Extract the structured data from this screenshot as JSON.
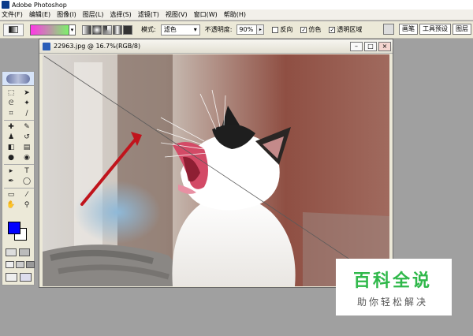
{
  "app": {
    "title": "Adobe Photoshop"
  },
  "menu": [
    "文件(F)",
    "编辑(E)",
    "图像(I)",
    "图层(L)",
    "选择(S)",
    "滤镜(T)",
    "视图(V)",
    "窗口(W)",
    "帮助(H)"
  ],
  "options": {
    "mode_label": "模式:",
    "mode_value": "滤色",
    "opacity_label": "不透明度:",
    "opacity_value": "90%",
    "reverse_label": "反向",
    "dither_label": "仿色",
    "transparency_label": "透明区域",
    "dither_checked": "✓",
    "transparency_checked": "✓"
  },
  "palette_well": {
    "tab1": "画笔",
    "tab2": "工具预设",
    "tab3": "图层"
  },
  "document": {
    "title": "22963.jpg @ 16.7%(RGB/8)"
  },
  "colors": {
    "foreground": "#0000ff",
    "background": "#ffffff",
    "accent_arrow": "#c0141c"
  },
  "watermark": {
    "logo": "百科全说",
    "subtitle": "助你轻松解决"
  },
  "icons": [
    "photoshop-logo",
    "gradient-tool-icon",
    "marquee-icon",
    "move-icon",
    "lasso-icon",
    "magic-wand-icon",
    "crop-icon",
    "slice-icon",
    "healing-icon",
    "brush-icon",
    "stamp-icon",
    "history-brush-icon",
    "eraser-icon",
    "gradient-icon",
    "blur-icon",
    "dodge-icon",
    "path-select-icon",
    "type-icon",
    "pen-icon",
    "shape-icon",
    "notes-icon",
    "eyedropper-icon",
    "hand-icon",
    "zoom-icon"
  ]
}
